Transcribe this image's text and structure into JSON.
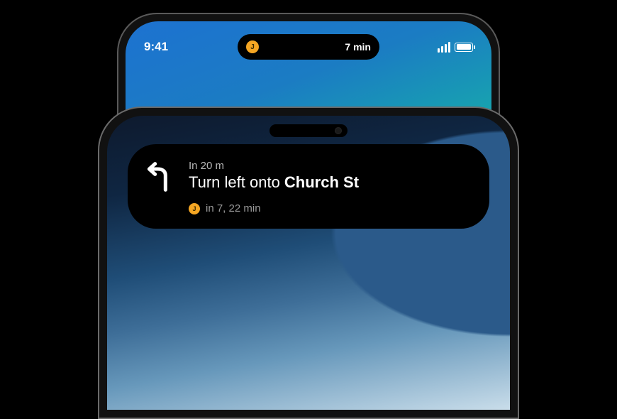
{
  "statusbar": {
    "time": "9:41"
  },
  "compact_island": {
    "app_initial": "J",
    "eta_text": "7 min"
  },
  "expanded_island": {
    "distance_label": "In 20 m",
    "instruction_prefix": "Turn left onto ",
    "instruction_bold": "Church St",
    "app_initial": "J",
    "eta_text": "in 7, 22 min"
  },
  "colors": {
    "accent_orange": "#f5a623"
  }
}
